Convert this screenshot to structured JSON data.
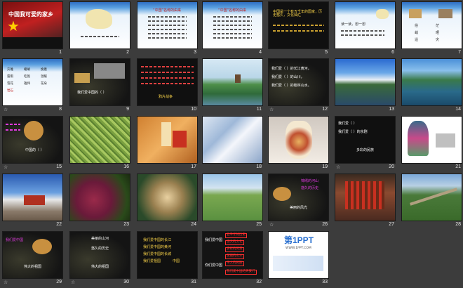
{
  "slides": [
    {
      "num": "1",
      "title": "中国我可爱的家乡"
    },
    {
      "num": "2"
    },
    {
      "num": "3",
      "heading": "“中国”名称的由来"
    },
    {
      "num": "4",
      "heading": "“中国”名称的由来"
    },
    {
      "num": "5",
      "text": "中国是一个有五千年的国家，历史悠久，文化灿烂"
    },
    {
      "num": "6",
      "text": "读一读，想一想"
    },
    {
      "num": "7",
      "words": [
        "俗",
        "茫",
        "峭",
        "晒",
        "遥",
        "灾"
      ]
    },
    {
      "num": "8",
      "words": [
        "灾难",
        "峻峭",
        "挽着",
        "雷雨",
        "吃饱",
        "温暖",
        "雪花",
        "雄伟",
        "花朵",
        "岩石"
      ]
    },
    {
      "num": "9",
      "text": "我们爱中国的（  ）"
    },
    {
      "num": "10",
      "text": "鸦片战争"
    },
    {
      "num": "11"
    },
    {
      "num": "12",
      "lines": [
        "我们爱（  ）的长江黄河，",
        "我们爱（  ）的山川，",
        "我们爱（  ）的桂林山水。"
      ]
    },
    {
      "num": "13"
    },
    {
      "num": "14"
    },
    {
      "num": "15",
      "text": "中国的（  ）"
    },
    {
      "num": "16"
    },
    {
      "num": "17"
    },
    {
      "num": "18"
    },
    {
      "num": "19"
    },
    {
      "num": "20",
      "lines": [
        "我们爱（  ）",
        "我们爱（  ）的京剧",
        "多彩的民族"
      ]
    },
    {
      "num": "21"
    },
    {
      "num": "22"
    },
    {
      "num": "23"
    },
    {
      "num": "24"
    },
    {
      "num": "25"
    },
    {
      "num": "26",
      "lines": [
        "锦绣的河山",
        "悠久的历史",
        "美丽的风光"
      ]
    },
    {
      "num": "27"
    },
    {
      "num": "28"
    },
    {
      "num": "29",
      "lines": [
        "我们爱中国",
        "伟大的祖国"
      ]
    },
    {
      "num": "30",
      "lines": [
        "美丽的山河",
        "悠久的历史",
        "伟大的祖国"
      ]
    },
    {
      "num": "31",
      "lines": [
        "我们爱中国的长江",
        "我们爱中国的黄河",
        "我们爱中国的长城",
        "我们爱祖国",
        "中国"
      ]
    },
    {
      "num": "32",
      "lines": [
        "我们爱中国",
        "你们爱中国"
      ],
      "items": [
        "五千年的历史",
        "悠久的文化",
        "多彩的风景",
        "美丽的山水",
        "伟大的民族",
        "我们爱中国的天安门"
      ]
    },
    {
      "num": "33",
      "logo": "第1PPT",
      "sub": "WWW.1PPT.COM"
    }
  ],
  "star_glyph": "☆",
  "colors": {
    "background": "#3c3c3c",
    "title_text": "#ffffff",
    "accent_red": "#e03030",
    "accent_yellow": "#ffe020"
  }
}
